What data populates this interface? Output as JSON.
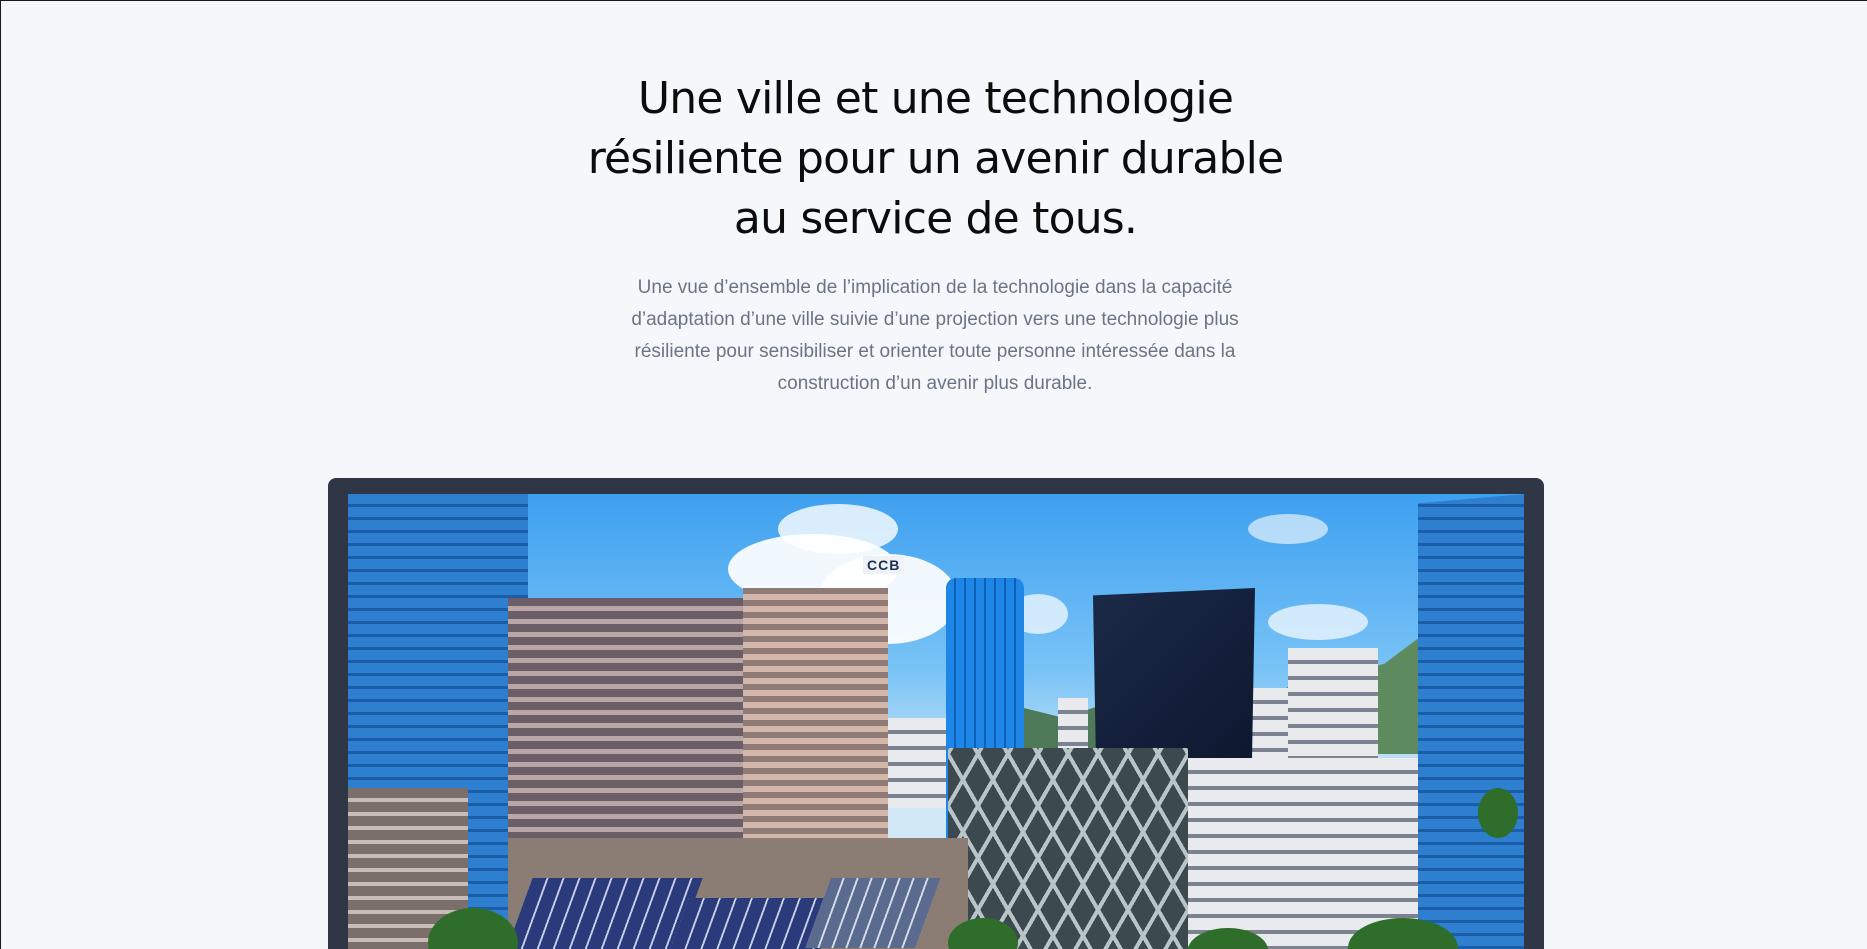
{
  "hero": {
    "title_line1": "Une ville et une technologie",
    "title_line2": "résiliente pour un avenir durable",
    "title_line3": "au service de tous.",
    "subtitle_line1": "Une vue d’ensemble de l’implication de la technologie dans la capacité",
    "subtitle_line2": "d’adaptation d’une ville suivie d’une projection vers une technologie plus",
    "subtitle_line3": "résiliente pour sensibiliser et orienter toute personne intéressée dans la",
    "subtitle_line4": "construction d’un avenir plus durable."
  },
  "image": {
    "sign_text": "CCB",
    "frame_color": "#2f3645"
  },
  "colors": {
    "background": "#f5f8fb",
    "title": "#0c0c0d",
    "subtitle": "#6b7484"
  }
}
